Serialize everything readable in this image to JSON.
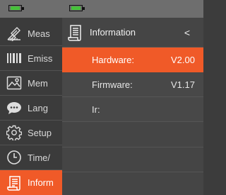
{
  "accent_color": "#f05a28",
  "battery_color": "#46c13a",
  "menu": {
    "items": [
      {
        "label": "Meas",
        "icon": "ruler-pen-icon"
      },
      {
        "label": "Emiss",
        "icon": "barcode-icon"
      },
      {
        "label": "Mem",
        "icon": "image-icon"
      },
      {
        "label": "Lang",
        "icon": "chat-bubble-icon"
      },
      {
        "label": "Setup",
        "icon": "gear-icon"
      },
      {
        "label": "Time/",
        "icon": "clock-icon"
      },
      {
        "label": "Inform",
        "icon": "document-icon"
      }
    ],
    "active_index": 6
  },
  "panel": {
    "title": "Information",
    "back_label": "<",
    "rows": [
      {
        "key": "Hardware:",
        "value": "V2.00"
      },
      {
        "key": "Firmware:",
        "value": "V1.17"
      },
      {
        "key": "Ir:",
        "value": ""
      }
    ],
    "selected_index": 0
  }
}
